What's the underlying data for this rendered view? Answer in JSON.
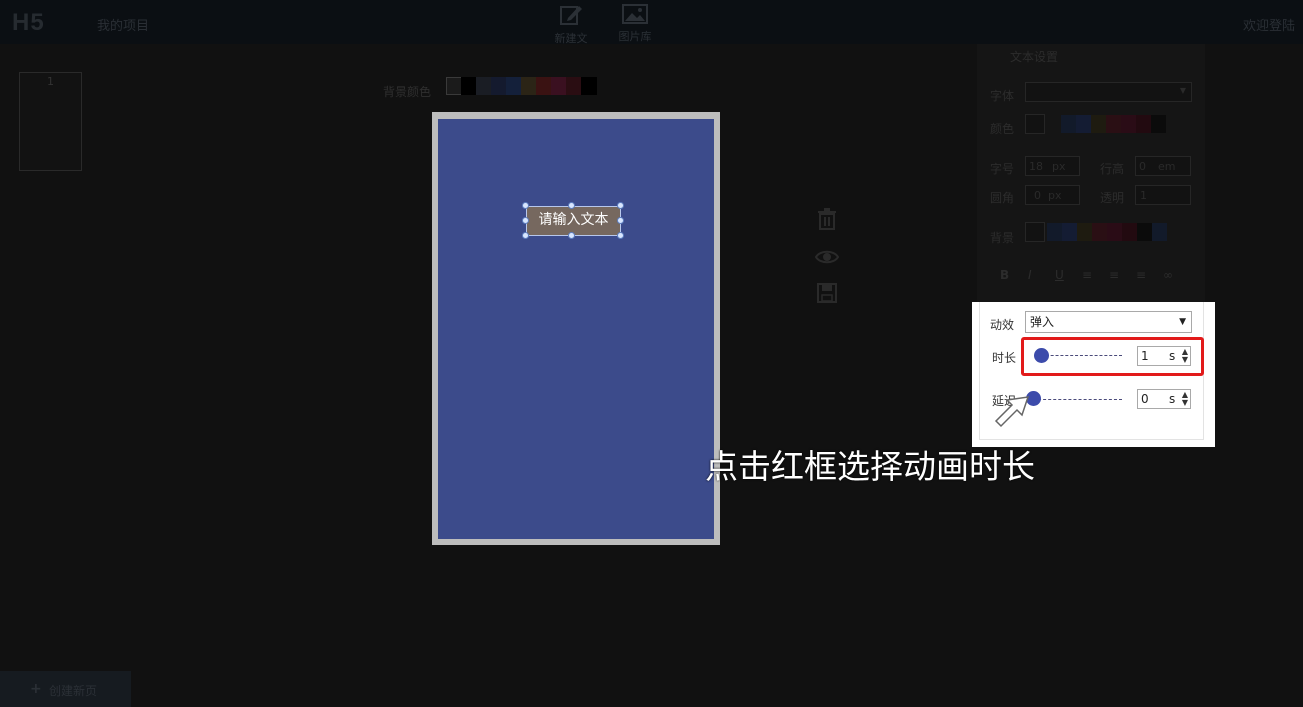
{
  "header": {
    "logo": "H5",
    "project_link": "我的项目",
    "tools": [
      {
        "label": "新建文",
        "icon": "edit-icon"
      },
      {
        "label": "图片库",
        "icon": "image-icon"
      }
    ],
    "welcome": "欢迎登陆"
  },
  "pages": {
    "thumbnails": [
      {
        "number": "1"
      }
    ],
    "add_label": "创建新页"
  },
  "canvas": {
    "bg_color_label": "背景颜色",
    "bg_swatches": [
      "#ffffff",
      "#000000",
      "#1a1d24",
      "#141a2e",
      "#14203a",
      "#2b2416",
      "#3a1212",
      "#3a1020",
      "#2a0d12",
      "#000000"
    ],
    "page_color": "#3c4b8b",
    "text_element": "请输入文本"
  },
  "side_tools": [
    {
      "icon": "trash-icon"
    },
    {
      "icon": "eye-icon"
    },
    {
      "icon": "save-icon"
    }
  ],
  "text_panel": {
    "title": "文本设置",
    "font_label": "字体",
    "color_label": "颜色",
    "size_label": "字号",
    "size_value": "18",
    "size_unit": "px",
    "line_height_label": "行高",
    "line_height_value": "0",
    "line_height_unit": "em",
    "radius_label": "圆角",
    "radius_value": "0",
    "radius_unit": "px",
    "opacity_label": "透明",
    "opacity_value": "1",
    "background_label": "背景",
    "format_buttons": [
      "B",
      "I",
      "U"
    ]
  },
  "animation_popup": {
    "effect_label": "动效",
    "effect_value": "弹入",
    "duration_label": "时长",
    "duration_value": "1",
    "duration_unit": "s",
    "delay_label": "延迟",
    "delay_value": "0",
    "delay_unit": "s",
    "accent_color": "#3c4bab",
    "highlight_color": "#e21a1a"
  },
  "caption": "点击红框选择动画时长"
}
